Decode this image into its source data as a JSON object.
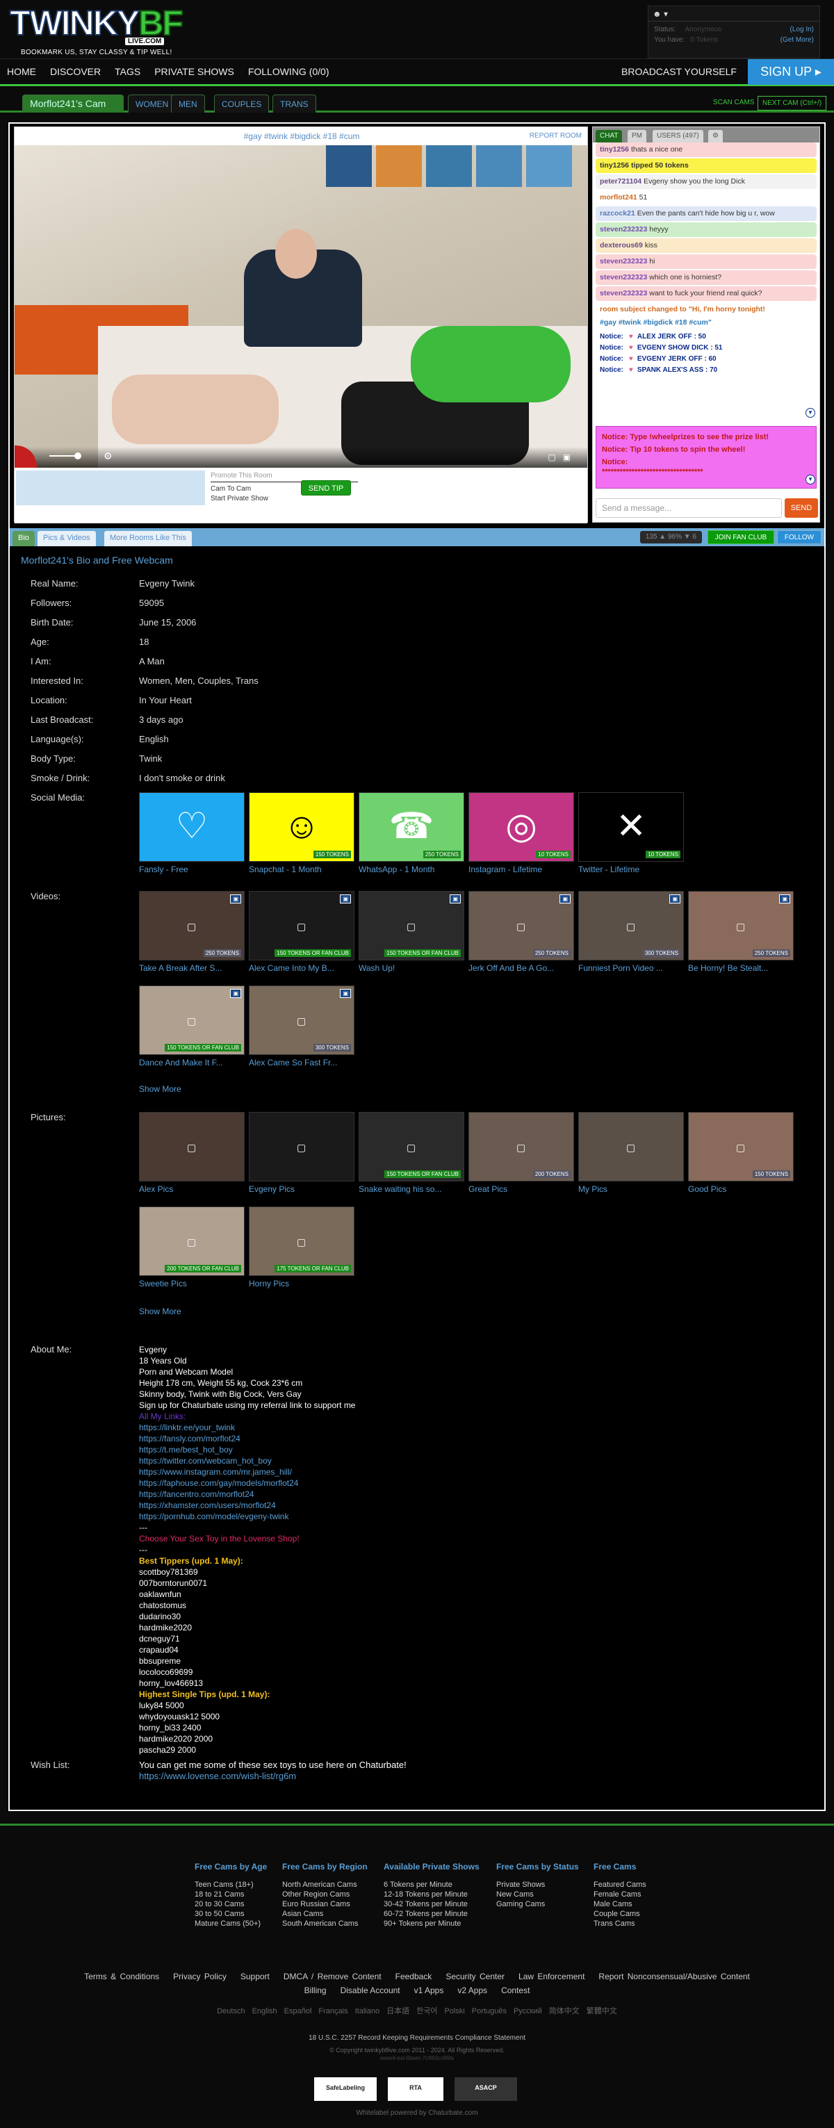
{
  "header": {
    "logo_part1": "TWINKY",
    "logo_part2": "BF",
    "logo_sub": "LIVE.COM",
    "tagline": "BOOKMARK US, STAY CLASSY & TIP WELL!",
    "user_menu": "▾",
    "status_label": "Status:",
    "status_value": "Anonymous",
    "login": "(Log In)",
    "you_have_label": "You have:",
    "tokens_value": "0 Tokens",
    "get_more": "(Get More)"
  },
  "nav": {
    "items": [
      "HOME",
      "DISCOVER",
      "TAGS",
      "PRIVATE SHOWS",
      "FOLLOWING (0/0)"
    ],
    "broadcast": "BROADCAST YOURSELF",
    "signup": "SIGN UP ▸"
  },
  "tabs": {
    "active": "Morflot241's Cam",
    "items": [
      "WOMEN",
      "MEN",
      "COUPLES",
      "TRANS"
    ],
    "scan": "SCAN CAMS",
    "next": "NEXT CAM (Ctrl+/)"
  },
  "video": {
    "subject": "#gay #twink #bigdick #18 #cum",
    "report": "REPORT ROOM",
    "promote": "Promote This Room",
    "cam_to_cam": "Cam To Cam",
    "start_private": "Start Private Show",
    "send_tip": "SEND TIP"
  },
  "chat": {
    "tabs": [
      "CHAT",
      "PM",
      "USERS (497)"
    ],
    "settings_icon": "gear-icon",
    "messages": [
      {
        "user": "tiny1256",
        "text": "thats a nice one",
        "bg": "#fbd5d5",
        "ucolor": "#6a4a8a"
      },
      {
        "user": "tiny1256",
        "text": "tipped 50 tokens",
        "bg": "#fbf24a",
        "ucolor": "#333",
        "bold": true
      },
      {
        "user": "peter721104",
        "text": "Evgeny show you the long Dick",
        "bg": "#f2f2f2",
        "ucolor": "#6a4a8a"
      },
      {
        "user": "morflot241",
        "text": "51",
        "bg": "#fff",
        "ucolor": "#d2691e"
      },
      {
        "user": "razcock21",
        "text": "Even the pants can't hide how big u r, wow",
        "bg": "#dfe7f7",
        "ucolor": "#5a7ab8"
      },
      {
        "user": "steven232323",
        "text": "heyyy",
        "bg": "#cdeec8",
        "ucolor": "#7a4ab8"
      },
      {
        "user": "dexterous69",
        "text": "kiss",
        "bg": "#fbe9c8",
        "ucolor": "#6a4a8a"
      },
      {
        "user": "steven232323",
        "text": "hi",
        "bg": "#fbd5d5",
        "ucolor": "#7a4ab8"
      },
      {
        "user": "steven232323",
        "text": "which one is horniest?",
        "bg": "#fbd5d5",
        "ucolor": "#7a4ab8"
      },
      {
        "user": "steven232323",
        "text": "want to fuck your friend real quick?",
        "bg": "#fbd5d5",
        "ucolor": "#7a4ab8"
      }
    ],
    "room_subject_notice": "room subject changed to \"Hi, I'm horny tonight!",
    "room_subject_tags": "#gay #twink #bigdick #18 #cum\"",
    "tip_notices": [
      {
        "label": "Notice:",
        "text": "ALEX JERK OFF : 50"
      },
      {
        "label": "Notice:",
        "text": "EVGENY SHOW DICK : 51"
      },
      {
        "label": "Notice:",
        "text": "EVGENY JERK OFF : 60"
      },
      {
        "label": "Notice:",
        "text": "SPANK ALEX'S ASS : 70"
      }
    ],
    "pink_notices": [
      "Notice: Type !wheelprizes to see the prize list!",
      "Notice: Tip 10 tokens to spin the wheel!",
      "Notice:",
      "**********************************"
    ],
    "input_placeholder": "Send a message...",
    "send": "SEND"
  },
  "bio_tabs": {
    "items": [
      "Bio",
      "Pics & Videos",
      "More Rooms Like This"
    ],
    "stats": "135 ▲ 96% ▼ 6",
    "join_fan_club": "JOIN FAN CLUB",
    "follow": "FOLLOW"
  },
  "bio": {
    "title": "Morflot241's Bio and Free Webcam",
    "fields": [
      {
        "label": "Real Name:",
        "value": "Evgeny Twink"
      },
      {
        "label": "Followers:",
        "value": "59095"
      },
      {
        "label": "Birth Date:",
        "value": "June 15, 2006"
      },
      {
        "label": "Age:",
        "value": "18"
      },
      {
        "label": "I Am:",
        "value": "A Man"
      },
      {
        "label": "Interested In:",
        "value": "Women, Men, Couples, Trans"
      },
      {
        "label": "Location:",
        "value": "In Your Heart"
      },
      {
        "label": "Last Broadcast:",
        "value": "3 days ago"
      },
      {
        "label": "Language(s):",
        "value": "English"
      },
      {
        "label": "Body Type:",
        "value": "Twink"
      },
      {
        "label": "Smoke / Drink:",
        "value": "I don't smoke or drink"
      }
    ],
    "social_label": "Social Media:",
    "social": [
      {
        "name": "Fansly - Free",
        "icon": "fansly-icon",
        "color": "#1fa9f0",
        "price": ""
      },
      {
        "name": "Snapchat - 1 Month",
        "icon": "snapchat-icon",
        "color": "#fffc00",
        "price": "150 TOKENS"
      },
      {
        "name": "WhatsApp - 1 Month",
        "icon": "whatsapp-icon",
        "color": "#6fd26f",
        "price": "250 TOKENS"
      },
      {
        "name": "Instagram - Lifetime",
        "icon": "instagram-icon",
        "color": "#c13584",
        "price": "10 TOKENS"
      },
      {
        "name": "Twitter - Lifetime",
        "icon": "x-icon",
        "color": "#000000",
        "price": "10 TOKENS"
      }
    ],
    "videos_label": "Videos:",
    "videos": [
      {
        "title": "Take A Break After S...",
        "price": "250 TOKENS",
        "fan": false
      },
      {
        "title": "Alex Came Into My B...",
        "price": "150 TOKENS OR FAN CLUB",
        "fan": true
      },
      {
        "title": "Wash Up!",
        "price": "150 TOKENS OR FAN CLUB",
        "fan": true
      },
      {
        "title": "Jerk Off And Be A Go...",
        "price": "250 TOKENS",
        "fan": false
      },
      {
        "title": "Funniest Porn Video ...",
        "price": "300 TOKENS",
        "fan": false
      },
      {
        "title": "Be Horny! Be Stealt...",
        "price": "250 TOKENS",
        "fan": false
      },
      {
        "title": "Dance And Make It F...",
        "price": "150 TOKENS OR FAN CLUB",
        "fan": true
      },
      {
        "title": "Alex Came So Fast Fr...",
        "price": "300 TOKENS",
        "fan": false
      }
    ],
    "pictures_label": "Pictures:",
    "pictures": [
      {
        "title": "Alex Pics",
        "price": "",
        "fan": false
      },
      {
        "title": "Evgeny Pics",
        "price": "",
        "fan": false
      },
      {
        "title": "Snake waiting his so...",
        "price": "150 TOKENS OR FAN CLUB",
        "fan": true
      },
      {
        "title": "Great Pics",
        "price": "200 TOKENS",
        "fan": false
      },
      {
        "title": "My Pics",
        "price": "",
        "fan": false
      },
      {
        "title": "Good Pics",
        "price": "150 TOKENS",
        "fan": false
      },
      {
        "title": "Sweetie Pics",
        "price": "200 TOKENS OR FAN CLUB",
        "fan": true
      },
      {
        "title": "Horny Pics",
        "price": "175 TOKENS OR FAN CLUB",
        "fan": true
      }
    ],
    "show_more": "Show More",
    "about_label": "About Me:",
    "about_lines": [
      {
        "t": "Evgeny",
        "c": ""
      },
      {
        "t": "18 Years Old",
        "c": ""
      },
      {
        "t": "Porn and Webcam Model",
        "c": ""
      },
      {
        "t": "Height 178 cm, Weight 55 kg, Cock 23*6 cm",
        "c": ""
      },
      {
        "t": "Skinny body, Twink with Big Cock, Vers Gay",
        "c": ""
      },
      {
        "t": "Sign up for Chaturbate using my referral link to support me",
        "c": ""
      },
      {
        "t": "All My Links:",
        "c": "purple"
      },
      {
        "t": "https://linktr.ee/your_twink",
        "c": "lnk"
      },
      {
        "t": "https://fansly.com/morflot24",
        "c": "lnk"
      },
      {
        "t": "https://t.me/best_hot_boy",
        "c": "lnk"
      },
      {
        "t": "https://twitter.com/webcam_hot_boy",
        "c": "lnk"
      },
      {
        "t": "https://www.instagram.com/mr.james_hill/",
        "c": "lnk"
      },
      {
        "t": "https://faphouse.com/gay/models/morflot24",
        "c": "lnk"
      },
      {
        "t": "https://fancentro.com/morflot24",
        "c": "lnk"
      },
      {
        "t": "https://xhamster.com/users/morflot24",
        "c": "lnk"
      },
      {
        "t": "https://pornhub.com/model/evgeny-twink",
        "c": "lnk"
      },
      {
        "t": "---",
        "c": ""
      },
      {
        "t": "Choose Your Sex Toy in the Lovense Shop!",
        "c": "pink"
      },
      {
        "t": "---",
        "c": ""
      },
      {
        "t": "Best Tippers (upd. 1 May):",
        "c": "gold"
      },
      {
        "t": "scottboy781369",
        "c": ""
      },
      {
        "t": "007borntorun0071",
        "c": ""
      },
      {
        "t": "oaklawnfun",
        "c": ""
      },
      {
        "t": "chatostomus",
        "c": ""
      },
      {
        "t": "dudarino30",
        "c": ""
      },
      {
        "t": "hardmike2020",
        "c": ""
      },
      {
        "t": "dcneguy71",
        "c": ""
      },
      {
        "t": "crapaud04",
        "c": ""
      },
      {
        "t": "bbsupreme",
        "c": ""
      },
      {
        "t": "locoloco69699",
        "c": ""
      },
      {
        "t": "horny_lov466913",
        "c": ""
      },
      {
        "t": "Highest Single Tips (upd. 1 May):",
        "c": "gold"
      },
      {
        "t": "luky84 5000",
        "c": ""
      },
      {
        "t": "whydoyouask12 5000",
        "c": ""
      },
      {
        "t": "horny_bi33 2400",
        "c": ""
      },
      {
        "t": "hardmike2020 2000",
        "c": ""
      },
      {
        "t": "pascha29 2000",
        "c": ""
      }
    ],
    "wishlist_label": "Wish List:",
    "wishlist_text": "You can get me some of these sex toys to use here on Chaturbate!",
    "wishlist_link": "https://www.lovense.com/wish-list/rg6m"
  },
  "footer": {
    "columns": [
      {
        "title": "Free Cams by Age",
        "items": [
          "Teen Cams (18+)",
          "18 to 21 Cams",
          "20 to 30 Cams",
          "30 to 50 Cams",
          "Mature Cams (50+)"
        ]
      },
      {
        "title": "Free Cams by Region",
        "items": [
          "North American Cams",
          "Other Region Cams",
          "Euro Russian Cams",
          "Asian Cams",
          "South American Cams"
        ]
      },
      {
        "title": "Available Private Shows",
        "items": [
          "6 Tokens per Minute",
          "12-18 Tokens per Minute",
          "30-42 Tokens per Minute",
          "60-72 Tokens per Minute",
          "90+ Tokens per Minute"
        ]
      },
      {
        "title": "Free Cams by Status",
        "items": [
          "Private Shows",
          "New Cams",
          "Gaming Cams"
        ]
      },
      {
        "title": "Free Cams",
        "items": [
          "Featured Cams",
          "Female Cams",
          "Male Cams",
          "Couple Cams",
          "Trans Cams"
        ]
      }
    ],
    "links": [
      "Terms & Conditions",
      "Privacy Policy",
      "Support",
      "DMCA / Remove Content",
      "Feedback",
      "Security Center",
      "Law Enforcement",
      "Report Nonconsensual/Abusive Content"
    ],
    "links2": [
      "Billing",
      "Disable Account",
      "v1 Apps",
      "v2 Apps",
      "Contest"
    ],
    "languages": [
      "Deutsch",
      "English",
      "Español",
      "Français",
      "Italiano",
      "日本語",
      "한국어",
      "Polski",
      "Português",
      "Русский",
      "简体中文",
      "繁體中文"
    ],
    "compliance": "18 U.S.C. 2257 Record Keeping Requirements Compliance Statement",
    "copyright": "© Copyright twinkybflive.com 2011 - 2024. All Rights Reserved.",
    "build": "www4-ext-libwm-7c993cc86fa",
    "badges": [
      "SafeLabeling",
      "RTA",
      "ASACP"
    ],
    "powered": "Whitelabel powered by Chaturbate.com"
  }
}
